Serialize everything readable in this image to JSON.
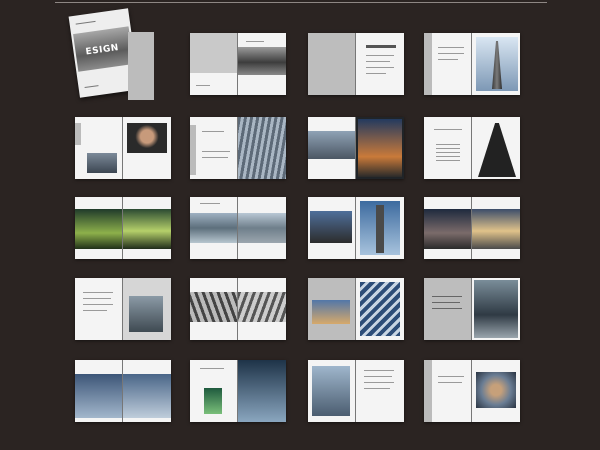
{
  "cover": {
    "title_text": "ESIGN"
  },
  "colors": {
    "background": "#2b2422",
    "page_white": "#f4f4f4",
    "page_gray": "#bdbdbd"
  }
}
